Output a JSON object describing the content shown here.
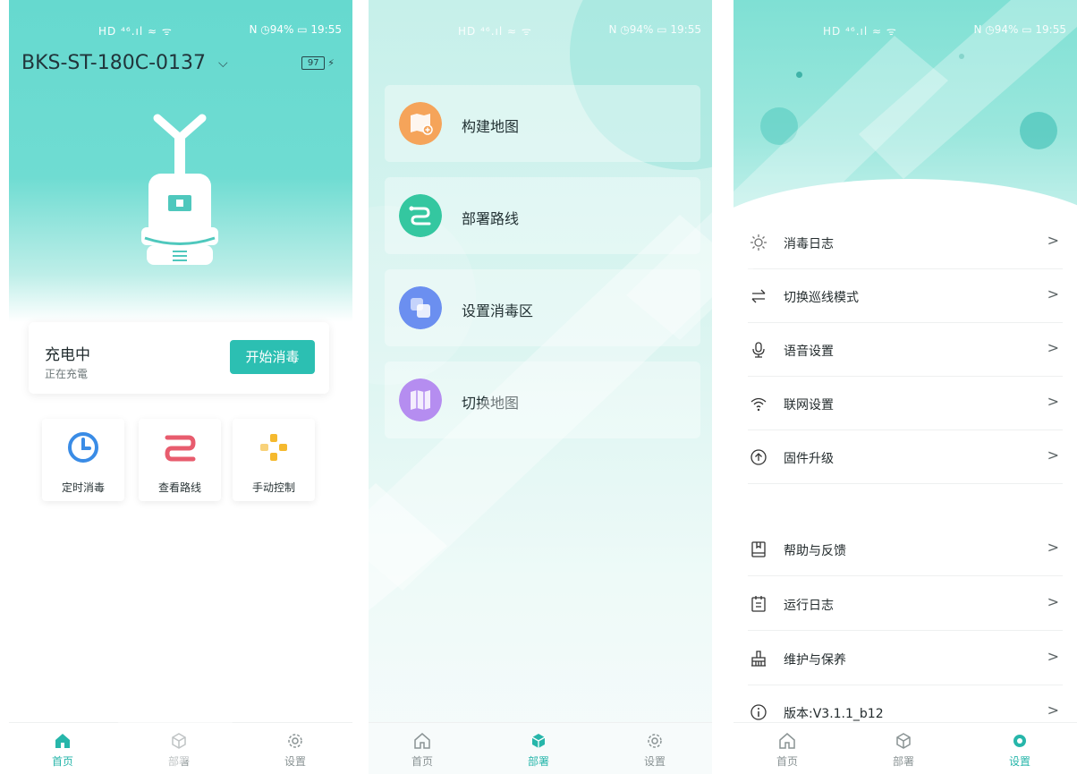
{
  "status_bar": {
    "left": "HD ⁴⁶.ıl ≈ ᯤ",
    "right": "N ◷94% ▭ 19:55"
  },
  "home": {
    "device_name": "BKS-ST-180C-0137",
    "battery_level": "97",
    "status_title": "充电中",
    "status_subtitle": "正在充電",
    "start_button": "开始消毒",
    "quick_actions": [
      {
        "label": "定时消毒",
        "icon": "clock-icon",
        "color": "#3a8ce6"
      },
      {
        "label": "查看路线",
        "icon": "route-icon",
        "color": "#e85c6e"
      },
      {
        "label": "手动控制",
        "icon": "dpad-icon",
        "color": "#f5b92e"
      }
    ]
  },
  "deploy": {
    "items": [
      {
        "label": "构建地图",
        "icon": "build-map-icon",
        "color": "#f5a45a"
      },
      {
        "label": "部署路线",
        "icon": "deploy-route-icon",
        "color": "#34c7a0"
      },
      {
        "label": "设置消毒区",
        "icon": "disinfect-zone-icon",
        "color": "#6b8ff0"
      },
      {
        "label": "切换地图",
        "icon": "switch-map-icon",
        "color": "#b58df0"
      }
    ]
  },
  "settings": {
    "items": [
      {
        "label": "消毒日志",
        "icon": "sun-icon"
      },
      {
        "label": "切换巡线模式",
        "icon": "swap-icon"
      },
      {
        "label": "语音设置",
        "icon": "microphone-icon"
      },
      {
        "label": "联网设置",
        "icon": "wifi-icon"
      },
      {
        "label": "固件升级",
        "icon": "upgrade-icon"
      },
      {
        "label": "帮助与反馈",
        "icon": "help-book-icon"
      },
      {
        "label": "运行日志",
        "icon": "log-icon"
      },
      {
        "label": "维护与保养",
        "icon": "maintenance-icon"
      },
      {
        "label": "版本:V3.1.1_b12",
        "icon": "info-icon"
      }
    ],
    "chevron": ">"
  },
  "tabs": {
    "home": "首页",
    "deploy": "部署",
    "settings": "设置"
  },
  "colors": {
    "accent": "#2cbfb2",
    "tab_active": "#27b6aa"
  }
}
